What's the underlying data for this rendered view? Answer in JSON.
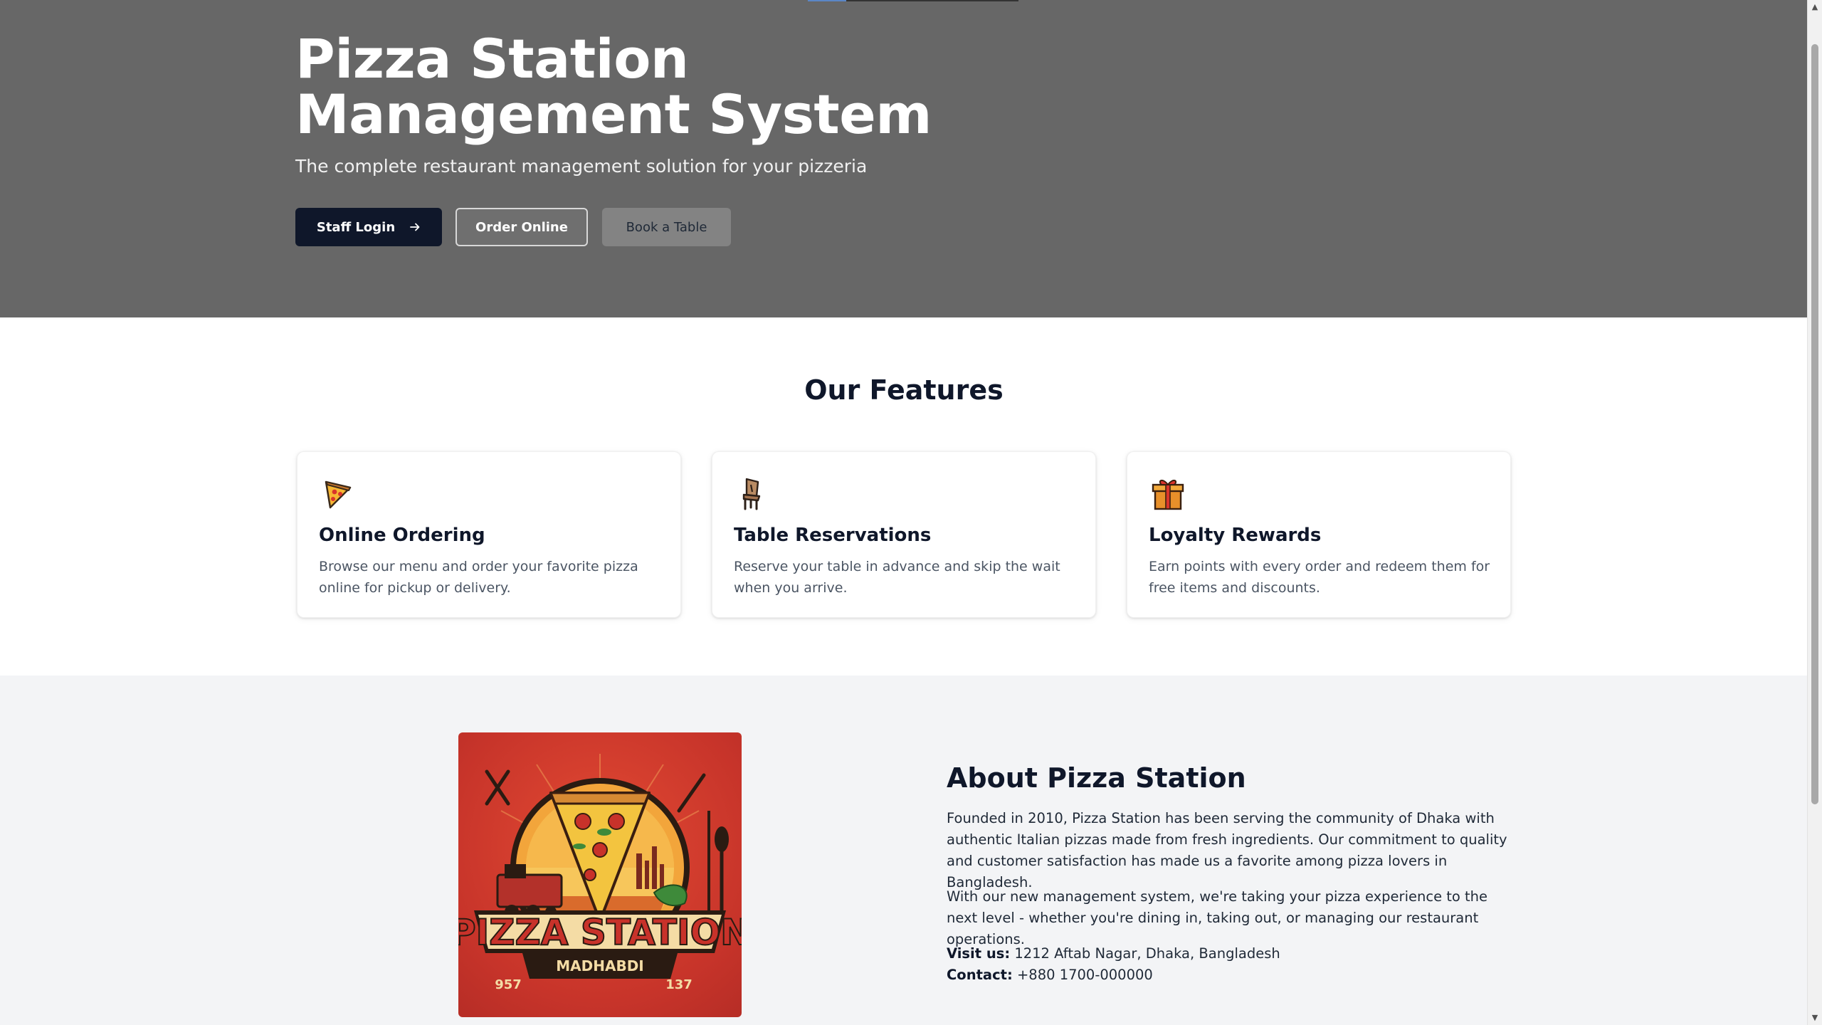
{
  "hero": {
    "title_line1": "Pizza Station",
    "title_line2": "Management System",
    "subtitle": "The complete restaurant management solution for your pizzeria",
    "buttons": {
      "staff_login": "Staff Login",
      "order_online": "Order Online",
      "book_table": "Book a Table"
    },
    "colors": {
      "background": "#676767",
      "primary_button": "#0f172a"
    }
  },
  "features": {
    "heading": "Our Features",
    "items": [
      {
        "icon": "pizza-slice-icon",
        "title": "Online Ordering",
        "description": "Browse our menu and order your favorite pizza online for pickup or delivery."
      },
      {
        "icon": "chair-icon",
        "title": "Table Reservations",
        "description": "Reserve your table in advance and skip the wait when you arrive."
      },
      {
        "icon": "gift-icon",
        "title": "Loyalty Rewards",
        "description": "Earn points with every order and redeem them for free items and discounts."
      }
    ]
  },
  "about": {
    "heading": "About Pizza Station",
    "paragraph1": "Founded in 2010, Pizza Station has been serving the community of Dhaka with authentic Italian pizzas made from fresh ingredients. Our commitment to quality and customer satisfaction has made us a favorite among pizza lovers in Bangladesh.",
    "paragraph2": "With our new management system, we're taking your pizza experience to the next level - whether you're dining in, taking out, or managing our restaurant operations.",
    "visit_label": "Visit us:",
    "visit_value": " 1212 Aftab Nagar, Dhaka, Bangladesh",
    "contact_label": "Contact:",
    "contact_value": " +880 1700-000000",
    "logo": {
      "brand_text": "PIZZA STATION",
      "sub_text": "MADHABDI",
      "left_number": "957",
      "right_number": "137"
    }
  }
}
